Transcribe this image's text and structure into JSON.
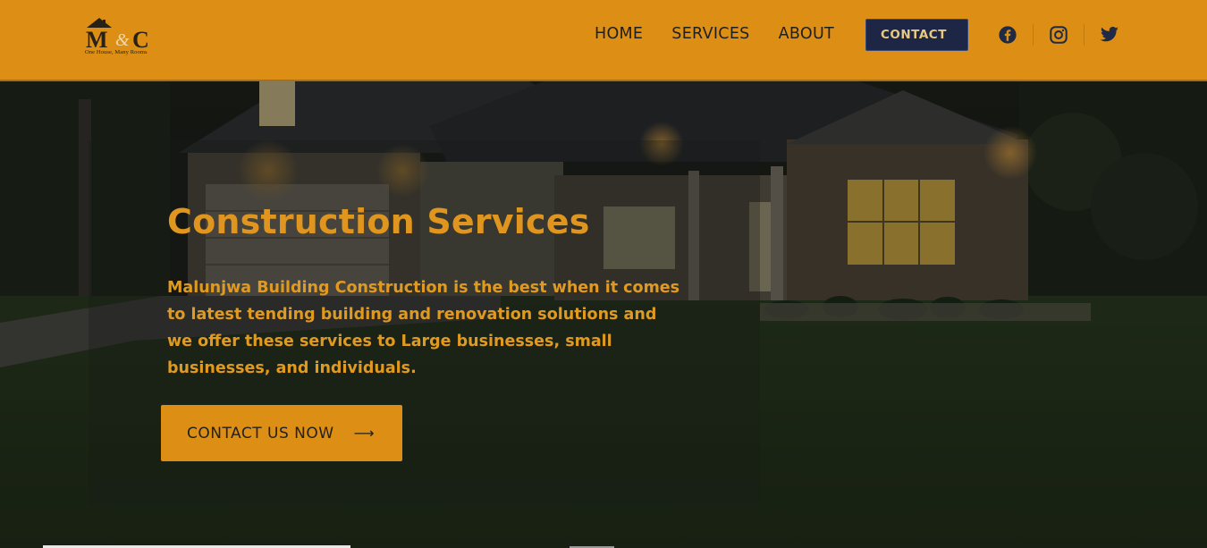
{
  "brand": {
    "logo_text": "M&C",
    "tagline": "One House, Many Rooms"
  },
  "nav": {
    "items": [
      {
        "label": "HOME"
      },
      {
        "label": "SERVICES"
      },
      {
        "label": "ABOUT"
      }
    ],
    "contact_label": "CONTACT"
  },
  "social": {
    "icons": [
      "facebook-icon",
      "instagram-icon",
      "twitter-icon"
    ]
  },
  "hero": {
    "title": "Construction Services",
    "text": "Malunjwa Building Construction is the best when it comes to latest tending building and renovation solutions and we offer these services to Large businesses, small businesses, and individuals.",
    "cta_label": "CONTACT US NOW",
    "cta_arrow": "⟶"
  },
  "colors": {
    "header_bg": "#dc8f14",
    "accent": "#e0961e",
    "contact_button_bg": "#1d2644"
  }
}
